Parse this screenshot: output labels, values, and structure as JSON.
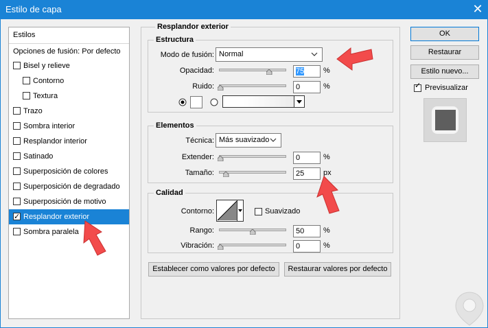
{
  "window": {
    "title": "Estilo de capa",
    "close_glyph": "✕"
  },
  "styles_list": {
    "header": "Estilos",
    "blend_options": "Opciones de fusión: Por defecto",
    "items": [
      {
        "label": "Bisel y relieve",
        "checked": false,
        "indent": 0
      },
      {
        "label": "Contorno",
        "checked": false,
        "indent": 1
      },
      {
        "label": "Textura",
        "checked": false,
        "indent": 1
      },
      {
        "label": "Trazo",
        "checked": false,
        "indent": 0
      },
      {
        "label": "Sombra interior",
        "checked": false,
        "indent": 0
      },
      {
        "label": "Resplandor interior",
        "checked": false,
        "indent": 0
      },
      {
        "label": "Satinado",
        "checked": false,
        "indent": 0
      },
      {
        "label": "Superposición de colores",
        "checked": false,
        "indent": 0
      },
      {
        "label": "Superposición de degradado",
        "checked": false,
        "indent": 0
      },
      {
        "label": "Superposición de motivo",
        "checked": false,
        "indent": 0
      },
      {
        "label": "Resplandor exterior",
        "checked": true,
        "indent": 0,
        "selected": true
      },
      {
        "label": "Sombra paralela",
        "checked": false,
        "indent": 0
      }
    ]
  },
  "panel": {
    "title": "Resplandor exterior",
    "estructura": {
      "title": "Estructura",
      "blend_mode_label": "Modo de fusión:",
      "blend_mode_value": "Normal",
      "opacity_label": "Opacidad:",
      "opacity_value": "75",
      "opacity_unit": "%",
      "noise_label": "Ruido:",
      "noise_value": "0",
      "noise_unit": "%"
    },
    "elementos": {
      "title": "Elementos",
      "technique_label": "Técnica:",
      "technique_value": "Más suavizado",
      "spread_label": "Extender:",
      "spread_value": "0",
      "spread_unit": "%",
      "size_label": "Tamaño:",
      "size_value": "25",
      "size_unit": "px"
    },
    "calidad": {
      "title": "Calidad",
      "contour_label": "Contorno:",
      "antialias_label": "Suavizado",
      "range_label": "Rango:",
      "range_value": "50",
      "range_unit": "%",
      "jitter_label": "Vibración:",
      "jitter_value": "0",
      "jitter_unit": "%"
    },
    "set_default_button": "Establecer como valores por defecto",
    "reset_default_button": "Restaurar valores por defecto"
  },
  "right": {
    "ok_button": "OK",
    "reset_button": "Restaurar",
    "new_style_button": "Estilo nuevo...",
    "preview_label": "Previsualizar",
    "preview_checked": true
  }
}
